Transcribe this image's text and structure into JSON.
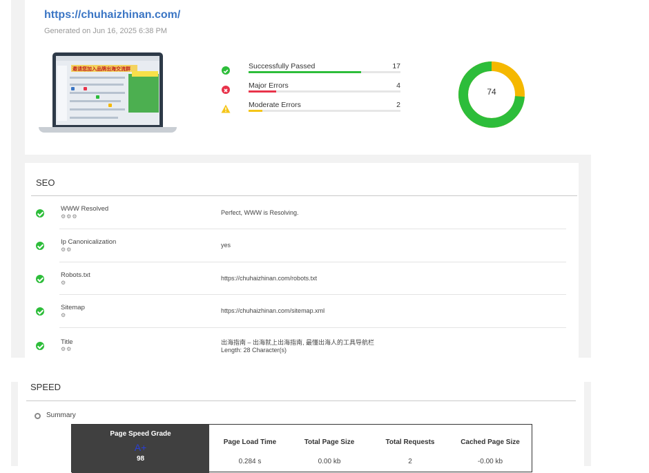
{
  "header": {
    "url": "https://chuhaizhinan.com/",
    "generated": "Generated on Jun 16, 2025 6:38 PM"
  },
  "thumbnail": {
    "banner_text": "邀请您加入品牌出海交流群"
  },
  "stats": [
    {
      "label": "Successfully Passed",
      "count": "17",
      "icon": "check-circle-icon",
      "color": "#2dbd3a",
      "fill": 0.74
    },
    {
      "label": "Major Errors",
      "count": "4",
      "icon": "error-circle-icon",
      "color": "#e8334a",
      "fill": 0.18
    },
    {
      "label": "Moderate Errors",
      "count": "2",
      "icon": "warning-triangle-icon",
      "color": "#f5c518",
      "fill": 0.09
    }
  ],
  "score": {
    "value": "74",
    "passed_color": "#2dbd3a",
    "other_color": "#f5b800",
    "passed_fraction": 0.74
  },
  "seo": {
    "title": "SEO",
    "rows": [
      {
        "name": "WWW Resolved",
        "gears": "⚙⚙⚙",
        "value": "Perfect, WWW is Resolving.",
        "value2": ""
      },
      {
        "name": "Ip Canonicalization",
        "gears": "⚙⚙",
        "value": "yes",
        "value2": ""
      },
      {
        "name": "Robots.txt",
        "gears": "⚙",
        "value": "https://chuhaizhinan.com/robots.txt",
        "value2": ""
      },
      {
        "name": "Sitemap",
        "gears": "⚙",
        "value": "https://chuhaizhinan.com/sitemap.xml",
        "value2": ""
      },
      {
        "name": "Title",
        "gears": "⚙⚙",
        "value": "出海指南 – 出海就上出海指南, 最懂出海人的工具导航栏",
        "value2": "Length: 28 Character(s)"
      }
    ]
  },
  "speed": {
    "title": "SPEED",
    "summary_label": "Summary",
    "grade_title": "Page Speed Grade",
    "grade_letter": "A+",
    "grade_score": "98",
    "columns": [
      {
        "head": "Page Load Time",
        "value": "0.284 s"
      },
      {
        "head": "Total Page Size",
        "value": "0.00 kb"
      },
      {
        "head": "Total Requests",
        "value": "2"
      },
      {
        "head": "Cached Page Size",
        "value": "-0.00 kb"
      }
    ]
  }
}
